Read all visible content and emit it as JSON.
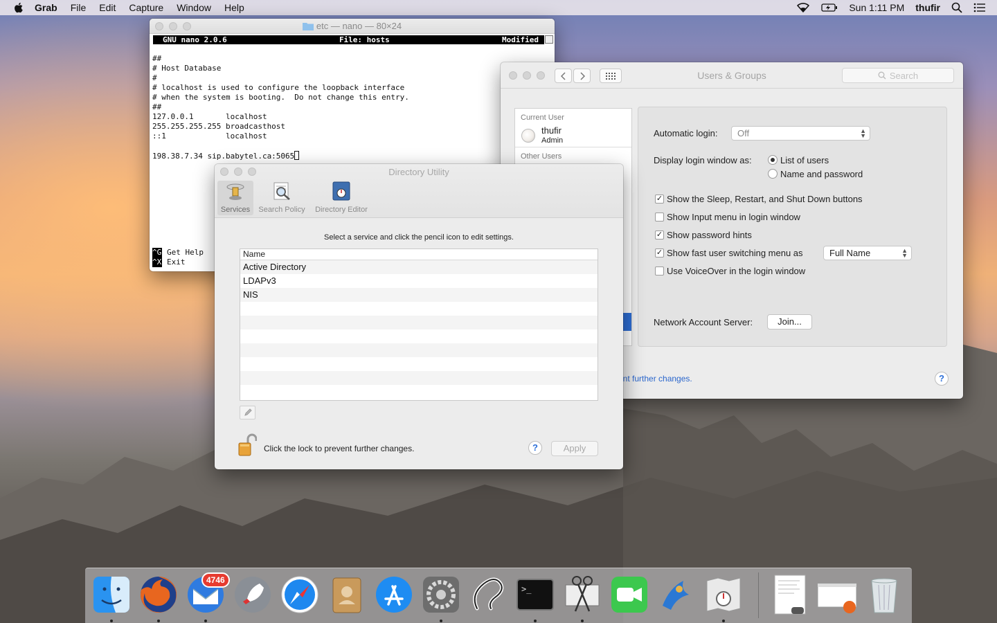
{
  "menubar": {
    "app_name": "Grab",
    "items": [
      "File",
      "Edit",
      "Capture",
      "Window",
      "Help"
    ],
    "clock": "Sun 1:11 PM",
    "user": "thufir"
  },
  "nano": {
    "title": "etc — nano — 80×24",
    "header_version": "GNU nano 2.0.6",
    "header_file": "File: hosts",
    "header_status": "Modified",
    "lines": [
      "##",
      "# Host Database",
      "#",
      "# localhost is used to configure the loopback interface",
      "# when the system is booting.  Do not change this entry.",
      "##",
      "127.0.0.1       localhost",
      "255.255.255.255 broadcasthost",
      "::1             localhost",
      "",
      "198.38.7.34 sip.babytel.ca:5065"
    ],
    "help": [
      {
        "key": "^G",
        "label": "Get Help"
      },
      {
        "key": "^X",
        "label": "Exit"
      }
    ]
  },
  "users_groups": {
    "title": "Users & Groups",
    "search_placeholder": "Search",
    "current_user_section": "Current User",
    "current_user": {
      "name": "thufir",
      "role": "Admin"
    },
    "other_users_section": "Other Users",
    "automatic_login_label": "Automatic login:",
    "automatic_login_value": "Off",
    "display_login_label": "Display login window as:",
    "display_options": [
      {
        "label": "List of users",
        "selected": true
      },
      {
        "label": "Name and password",
        "selected": false
      }
    ],
    "checkboxes": [
      {
        "label": "Show the Sleep, Restart, and Shut Down buttons",
        "checked": true
      },
      {
        "label": "Show Input menu in login window",
        "checked": false
      },
      {
        "label": "Show password hints",
        "checked": true
      },
      {
        "label": "Show fast user switching menu as",
        "checked": true
      },
      {
        "label": "Use VoiceOver in the login window",
        "checked": false
      }
    ],
    "fast_switch_value": "Full Name",
    "network_label": "Network Account Server:",
    "join_label": "Join...",
    "lock_message_partial": "ent further changes.",
    "help_glyph": "?"
  },
  "directory_utility": {
    "title": "Directory Utility",
    "tabs": [
      {
        "label": "Services",
        "selected": true
      },
      {
        "label": "Search Policy",
        "selected": false
      },
      {
        "label": "Directory Editor",
        "selected": false
      }
    ],
    "instructions": "Select a service and click the pencil icon to edit settings.",
    "column_header": "Name",
    "services": [
      "Active Directory",
      "LDAPv3",
      "NIS",
      "",
      "",
      "",
      "",
      "",
      "",
      ""
    ],
    "lock_message": "Click the lock to prevent further changes.",
    "apply_label": "Apply",
    "help_glyph": "?"
  },
  "dock": {
    "mail_badge": "4746",
    "icons": [
      "finder-icon",
      "firefox-icon",
      "mail-icon",
      "launchpad-icon",
      "safari-icon",
      "contacts-icon",
      "app-store-icon",
      "system-preferences-icon",
      "cydia-icon",
      "terminal-icon",
      "grab-icon",
      "facetime-icon",
      "network-radar-icon",
      "directory-utility-icon",
      "document-preview-icon",
      "firefox-window-preview-icon",
      "trash-icon"
    ]
  },
  "colors": {
    "accent_blue": "#2e6ed5",
    "badge_red": "#e63b30"
  }
}
